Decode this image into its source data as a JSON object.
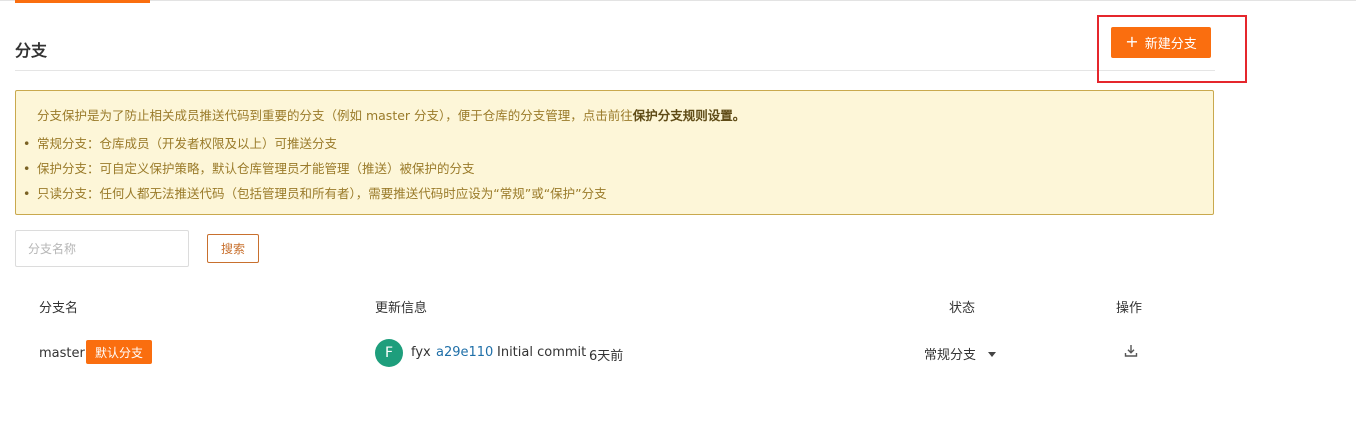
{
  "header": {
    "title": "分支",
    "new_branch_label": "新建分支",
    "new_branch_icon": "plus-icon"
  },
  "notice": {
    "intro_text": "分支保护是为了防止相关成员推送代码到重要的分支（例如 master 分支），便于仓库的分支管理，点击前往",
    "intro_link": "保护分支规则设置。",
    "items": [
      "常规分支：仓库成员（开发者权限及以上）可推送分支",
      "保护分支：可自定义保护策略，默认仓库管理员才能管理（推送）被保护的分支",
      "只读分支：任何人都无法推送代码（包括管理员和所有者），需要推送代码时应设为“常规”或“保护”分支"
    ]
  },
  "search": {
    "placeholder": "分支名称",
    "button_label": "搜索"
  },
  "table": {
    "columns": [
      "分支名",
      "更新信息",
      "状态",
      "操作"
    ],
    "rows": [
      {
        "branch": "master",
        "badge": "默认分支",
        "avatar_letter": "F",
        "author": "fyx",
        "commit_hash": "a29e110",
        "commit_message": "Initial commit",
        "time": "6天前",
        "status": "常规分支",
        "action_icon": "download-icon"
      }
    ]
  },
  "colors": {
    "accent": "#fa6e0f",
    "highlight": "#e5262c",
    "notice_bg": "#fdf6d8",
    "avatar": "#1e9e7c"
  }
}
